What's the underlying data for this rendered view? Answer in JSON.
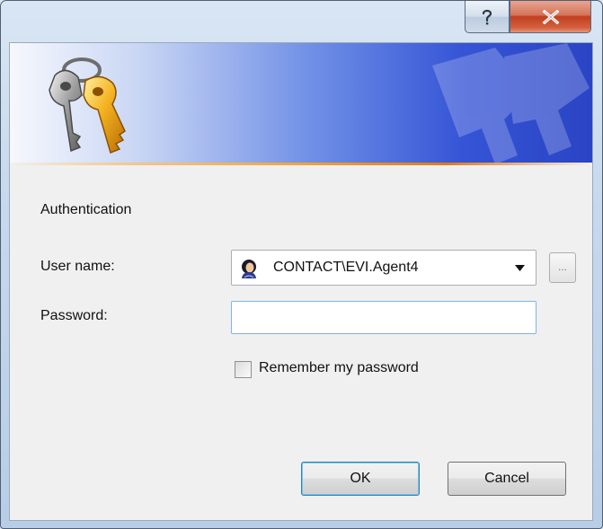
{
  "window": {
    "help_icon": "help-question-icon",
    "close_icon": "close-x-icon"
  },
  "banner": {
    "logo_icon": "keys-icon"
  },
  "form": {
    "section_title": "Authentication",
    "username_label": "User name:",
    "username_value": "CONTACT\\EVI.Agent4",
    "browse_label": "...",
    "password_label": "Password:",
    "password_value": "",
    "remember_label": "Remember my password",
    "remember_checked": false
  },
  "buttons": {
    "ok_label": "OK",
    "cancel_label": "Cancel"
  }
}
